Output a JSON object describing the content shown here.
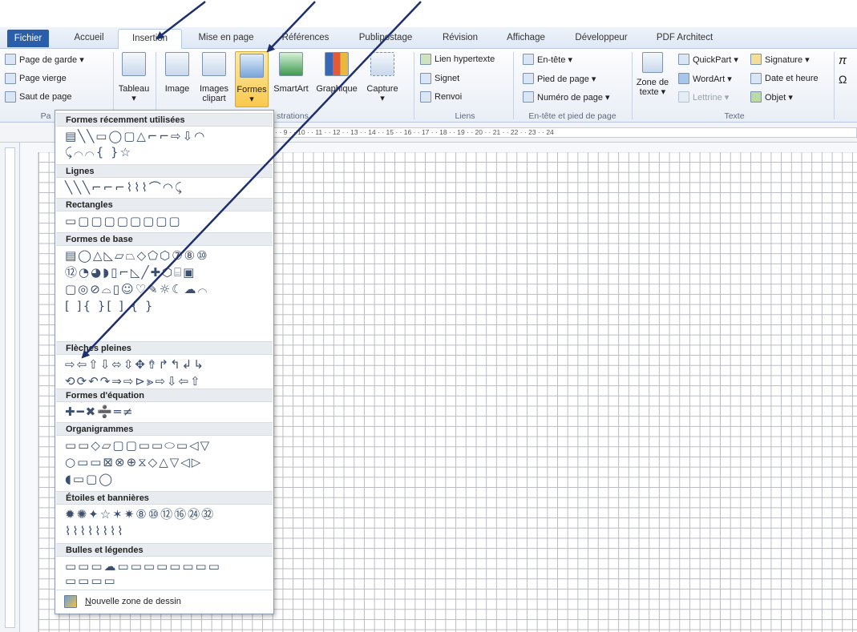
{
  "tabs": [
    "Fichier",
    "Accueil",
    "Insertion",
    "Mise en page",
    "Références",
    "Publipostage",
    "Révision",
    "Affichage",
    "Développeur",
    "PDF Architect"
  ],
  "ribbon": {
    "pages": {
      "page_de_garde": "Page de garde ▾",
      "page_vierge": "Page vierge",
      "saut_de_page": "Saut de page",
      "group": "Pa"
    },
    "tableau": "Tableau",
    "image": "Image",
    "images_clipart": "Images clipart",
    "formes": "Formes",
    "smartart": "SmartArt",
    "graphique": "Graphique",
    "capture": "Capture",
    "illustrations_group": "strations",
    "liens": {
      "lien_hypertexte": "Lien hypertexte",
      "signet": "Signet",
      "renvoi": "Renvoi",
      "group": "Liens"
    },
    "entete": {
      "en_tete": "En-tête ▾",
      "pied_de_page": "Pied de page ▾",
      "numero_de_page": "Numéro de page ▾",
      "group": "En-tête et pied de page"
    },
    "texte": {
      "zone_de_texte": "Zone de texte ▾",
      "quickpart": "QuickPart ▾",
      "wordart": "WordArt ▾",
      "lettrine": "Lettrine ▾",
      "signature": "Signature ▾",
      "date_et_heure": "Date et heure",
      "objet": "Objet ▾",
      "group": "Texte"
    }
  },
  "ruler_ticks": "· 8 · · 9 · · 10 · · 11 · · 12 · · 13 · · 14 · · 15 · · 16 · · 17 · · 18 · · 19 · · 20 · · 21 · · 22 · · 23 · · 24",
  "shapes_menu": {
    "sections": [
      {
        "title": "Formes récemment utilisées",
        "rows": [
          "▤╲╲▭◯▢△⌐⌐⇨⇩◠",
          "⤹⌒⌒{ }☆"
        ]
      },
      {
        "title": "Lignes",
        "rows": [
          "╲╲╲⌐⌐⌐⌇⌇⌇⌒◠⤹"
        ]
      },
      {
        "title": "Rectangles",
        "rows": [
          "▭▢▢▢▢▢▢▢▢"
        ]
      },
      {
        "title": "Formes de base",
        "rows": [
          "▤◯△◺▱⏢◇⬠⬡⑦⑧⑩",
          "⑫◔◕◗▯⌐◺╱✚⬡⌸▣",
          "▢◎⊘⌓▯☺♡✎☼☾☁⌒",
          "[ ]{ }[ ] { }"
        ]
      },
      {
        "title": "Flèches pleines",
        "rows": [
          "⇨⇦⇧⇩⬄⇳✥⇮↱↰↲↳",
          "⟲⟳↶↷⇒⇨⊳⪢⇨⇩⇦⇧",
          "⇩✥⤼"
        ]
      },
      {
        "title": "Formes d'équation",
        "rows": [
          "✚━✖➗═≠"
        ]
      },
      {
        "title": "Organigrammes",
        "rows": [
          "▭▭◇▱▢▢▭▭⬭▭◁▽",
          "○▭▭⊠⊗⊕⧖◇△▽◁▷",
          "◖▭▢◯"
        ]
      },
      {
        "title": "Étoiles et bannières",
        "rows": [
          "✹✺✦☆✶✷⑧⑩⑫⑯㉔㉜",
          "⌇⌇⌇⌇⌇⌇⌇⌇"
        ]
      },
      {
        "title": "Bulles et légendes",
        "rows": [
          "▭▭▭☁▭▭▭▭▭▭▭▭",
          "▭▭▭▭"
        ]
      }
    ],
    "new_canvas_prefix": "N",
    "new_canvas_rest": "ouvelle zone de dessin"
  }
}
